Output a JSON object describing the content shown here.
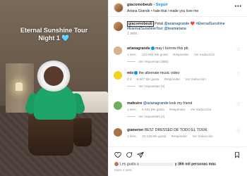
{
  "media": {
    "caption_line1": "Eternal Sunshine Tour",
    "caption_line2": "Night 1 🩵"
  },
  "header": {
    "username": "giacomobeub",
    "separator": "•",
    "follow_label": "Seguir",
    "audio": "Ariana Grande • hate that i made you love me",
    "more_icon": "more-icon"
  },
  "post": {
    "username": "giacomobeub",
    "text_a": " Petal ",
    "mention_1": "@arianagrande",
    "heart": " ❤️ ",
    "hashtag_1": "#EternalSunshine",
    "hashtag_2": "#EternalSunshineTour",
    "mention_2": "@teamariana",
    "time": "1 sem."
  },
  "comments": [
    {
      "username": "arianagrande",
      "text": "may i borrow this pb",
      "time": "1 sem.",
      "likes": "124.961 Me gusta",
      "reply": "Responder",
      "translate": "Ver traducción",
      "replies": "Ver respuestas (886)",
      "avatar_color": "#d8b28e"
    },
    {
      "username": "mtv",
      "text": "the alternate music video",
      "time": "4 d",
      "likes": "8.847 Me gusta",
      "reply": "Responder",
      "translate": "Ver traducción",
      "replies": "Ver respuestas (5)",
      "avatar_color": "#f2d21b"
    },
    {
      "username": "mafesire",
      "text_mention": "@arianagrande",
      "text": " look my friend",
      "time": "1 sem.",
      "likes": "6.481 Me gusta",
      "reply": "Responder",
      "translate": "Ver traducción",
      "replies": "Ver respuestas (2)",
      "avatar_color": "#6fae5a"
    },
    {
      "username": "giamerier",
      "text": "BEST DRESSED DE TODO EL TOUR.",
      "time": "1 sem.",
      "likes": "10.138 Me gusta",
      "reply": "Responder",
      "translate": "Ver traducción",
      "replies": "",
      "avatar_color": "#a6714b"
    }
  ],
  "actions": {
    "like_icon": "heart-icon",
    "comment_icon": "comment-icon",
    "share_icon": "share-icon",
    "save_icon": "bookmark-icon",
    "likes_prefix": "Les gusta a ",
    "likes_suffix": "y 366 mil personas más",
    "time": "Hace 1 sem."
  },
  "colors": {
    "accent": "#0095f6",
    "link": "#00376b",
    "muted": "#8e8e8e"
  }
}
